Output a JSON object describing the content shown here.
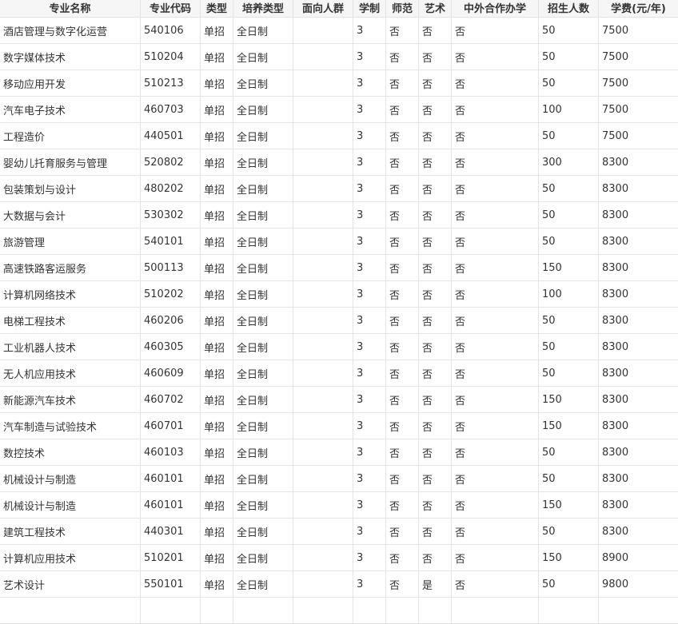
{
  "table": {
    "headers": [
      "专业名称",
      "专业代码",
      "类型",
      "培养类型",
      "面向人群",
      "学制",
      "师范",
      "艺术",
      "中外合作办学",
      "招生人数",
      "学费(元/年)"
    ],
    "rows": [
      [
        "酒店管理与数字化运营",
        "540106",
        "单招",
        "全日制",
        "",
        "3",
        "否",
        "否",
        "否",
        "50",
        "7500"
      ],
      [
        "数字媒体技术",
        "510204",
        "单招",
        "全日制",
        "",
        "3",
        "否",
        "否",
        "否",
        "50",
        "7500"
      ],
      [
        "移动应用开发",
        "510213",
        "单招",
        "全日制",
        "",
        "3",
        "否",
        "否",
        "否",
        "50",
        "7500"
      ],
      [
        "汽车电子技术",
        "460703",
        "单招",
        "全日制",
        "",
        "3",
        "否",
        "否",
        "否",
        "100",
        "7500"
      ],
      [
        "工程造价",
        "440501",
        "单招",
        "全日制",
        "",
        "3",
        "否",
        "否",
        "否",
        "50",
        "7500"
      ],
      [
        "婴幼儿托育服务与管理",
        "520802",
        "单招",
        "全日制",
        "",
        "3",
        "否",
        "否",
        "否",
        "300",
        "8300"
      ],
      [
        "包装策划与设计",
        "480202",
        "单招",
        "全日制",
        "",
        "3",
        "否",
        "否",
        "否",
        "50",
        "8300"
      ],
      [
        "大数据与会计",
        "530302",
        "单招",
        "全日制",
        "",
        "3",
        "否",
        "否",
        "否",
        "50",
        "8300"
      ],
      [
        "旅游管理",
        "540101",
        "单招",
        "全日制",
        "",
        "3",
        "否",
        "否",
        "否",
        "50",
        "8300"
      ],
      [
        "高速铁路客运服务",
        "500113",
        "单招",
        "全日制",
        "",
        "3",
        "否",
        "否",
        "否",
        "150",
        "8300"
      ],
      [
        "计算机网络技术",
        "510202",
        "单招",
        "全日制",
        "",
        "3",
        "否",
        "否",
        "否",
        "100",
        "8300"
      ],
      [
        "电梯工程技术",
        "460206",
        "单招",
        "全日制",
        "",
        "3",
        "否",
        "否",
        "否",
        "50",
        "8300"
      ],
      [
        "工业机器人技术",
        "460305",
        "单招",
        "全日制",
        "",
        "3",
        "否",
        "否",
        "否",
        "50",
        "8300"
      ],
      [
        "无人机应用技术",
        "460609",
        "单招",
        "全日制",
        "",
        "3",
        "否",
        "否",
        "否",
        "50",
        "8300"
      ],
      [
        "新能源汽车技术",
        "460702",
        "单招",
        "全日制",
        "",
        "3",
        "否",
        "否",
        "否",
        "150",
        "8300"
      ],
      [
        "汽车制造与试验技术",
        "460701",
        "单招",
        "全日制",
        "",
        "3",
        "否",
        "否",
        "否",
        "150",
        "8300"
      ],
      [
        "数控技术",
        "460103",
        "单招",
        "全日制",
        "",
        "3",
        "否",
        "否",
        "否",
        "50",
        "8300"
      ],
      [
        "机械设计与制造",
        "460101",
        "单招",
        "全日制",
        "",
        "3",
        "否",
        "否",
        "否",
        "50",
        "8300"
      ],
      [
        "机械设计与制造",
        "460101",
        "单招",
        "全日制",
        "",
        "3",
        "否",
        "否",
        "否",
        "150",
        "8300"
      ],
      [
        "建筑工程技术",
        "440301",
        "单招",
        "全日制",
        "",
        "3",
        "否",
        "否",
        "否",
        "50",
        "8300"
      ],
      [
        "计算机应用技术",
        "510201",
        "单招",
        "全日制",
        "",
        "3",
        "否",
        "否",
        "否",
        "150",
        "8900"
      ],
      [
        "艺术设计",
        "550101",
        "单招",
        "全日制",
        "",
        "3",
        "否",
        "是",
        "否",
        "50",
        "9800"
      ],
      [
        "",
        "",
        "",
        "",
        "",
        "",
        "",
        "",
        "",
        "",
        ""
      ]
    ]
  }
}
